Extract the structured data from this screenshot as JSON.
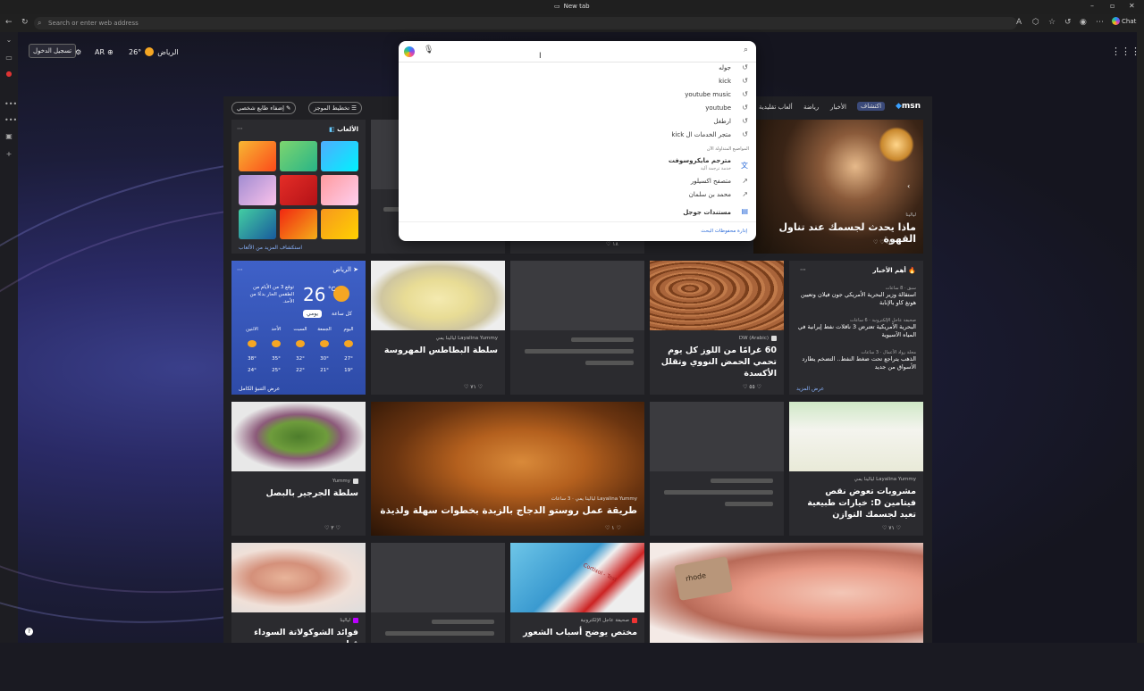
{
  "browser": {
    "tab_title": "New tab",
    "address_placeholder": "Search or enter web address",
    "chat_label": "Chat"
  },
  "topbar": {
    "login_label": "تسجيل الدخول",
    "language": "AR",
    "temperature": "26°",
    "city": "الرياض"
  },
  "search_popup": {
    "history": [
      "جوله",
      "kick",
      "youtube music",
      "youtube",
      "ارطغل",
      "متجر الخدمات ال kick"
    ],
    "section_label": "المواضيع المتداولة الآن",
    "suggestions": [
      {
        "title": "مترجم مايكروسوفت",
        "subtitle": "خدمة ترجمة آلية",
        "icon": "translator-icon"
      },
      {
        "title": "متصفح اكسيلور",
        "icon": "trending-icon"
      },
      {
        "title": "محمد بن سلمان",
        "icon": "trending-icon"
      }
    ],
    "docs_label": "مستندات جوجل",
    "manage_label": "إدارة محفوظات البحث"
  },
  "feed": {
    "logo": "msn",
    "nav": [
      "اكتشاف",
      "الأخبار",
      "رياضة",
      "ألعاب تقليدية"
    ],
    "layout_btn": "تخطيط الموجز",
    "personalize_btn": "إضفاء طابع شخصي",
    "games": {
      "title": "الألعاب",
      "more": "استكشاف المزيد من الألعاب"
    },
    "hero": {
      "source": "ليالينا",
      "title": "ماذا يحدث لجسمك عند تناول القهوة",
      "likes": "٢٥٧"
    },
    "small_likes": "١٨",
    "weather": {
      "city": "الرياض",
      "temp": "26",
      "unit": "°C",
      "desc": "توقع 3 من الأيام من الطقس الحار بدءًا من الأحد.",
      "tab_hourly": "كل ساعة",
      "tab_daily": "يومي",
      "days": [
        "اليوم",
        "الجمعة",
        "السبت",
        "الأحد",
        "الاثنين"
      ],
      "highs": [
        "27°",
        "30°",
        "32°",
        "35°",
        "38°"
      ],
      "lows": [
        "19°",
        "21°",
        "22°",
        "25°",
        "24°"
      ],
      "full": "عرض التنبؤ الكامل"
    },
    "potato": {
      "source": "Layalina Yummy ليالينا يمي",
      "title": "سلطة البطاطس المهروسة",
      "likes": "٧١"
    },
    "almond": {
      "source": "DW (Arabic)",
      "title": "60 غرامًا من اللوز كل يوم تحمي الحمض النووي وتقلل الأكسدة",
      "likes": "٥٥"
    },
    "news": {
      "title": "أهم الأخبار",
      "items": [
        {
          "source": "سبق · 8 ساعات",
          "text": "استقالة وزير البحرية الأمريكي جون فيلان وتعيين هونغ كاو بالإنابة"
        },
        {
          "source": "صحيفة عاجل الإلكترونية · 6 ساعات",
          "text": "البحرية الأمريكية تعترض 3 ناقلات نفط إيرانية في المياه الآسيوية"
        },
        {
          "source": "مجلة رواد الأعمال · 3 ساعات",
          "text": "الذهب يتراجع تحت ضغط النفط.. التضخم يطارد الأسواق من جديد"
        }
      ],
      "more": "عرض المزيد"
    },
    "salad": {
      "source": "Yummy",
      "title": "سلطة الجرجير بالبصل",
      "likes": "٣"
    },
    "chicken": {
      "source": "Layalina Yummy ليالينا يمي · 3 ساعات",
      "title": "طريقة عمل روستو الدجاج بالزبدة بخطوات سهلة ولذيذة",
      "likes": "١"
    },
    "milk": {
      "source": "Layalina Yummy ليالينا يمي",
      "title": "مشروبات تعوض نقص فيتامين D: خيارات طبيعية تعيد لجسمك التوازن",
      "likes": "٧١"
    },
    "choco": {
      "source": "ليالينا",
      "title": "فوائد الشوكولاتة السوداء قبل"
    },
    "hair": {
      "source": "صحيفة عاجل الإلكترونية",
      "title": "مختص يوضح أسباب الشعور"
    },
    "blood_label": "Cortisol - Test",
    "rhode_label": "rhode"
  }
}
